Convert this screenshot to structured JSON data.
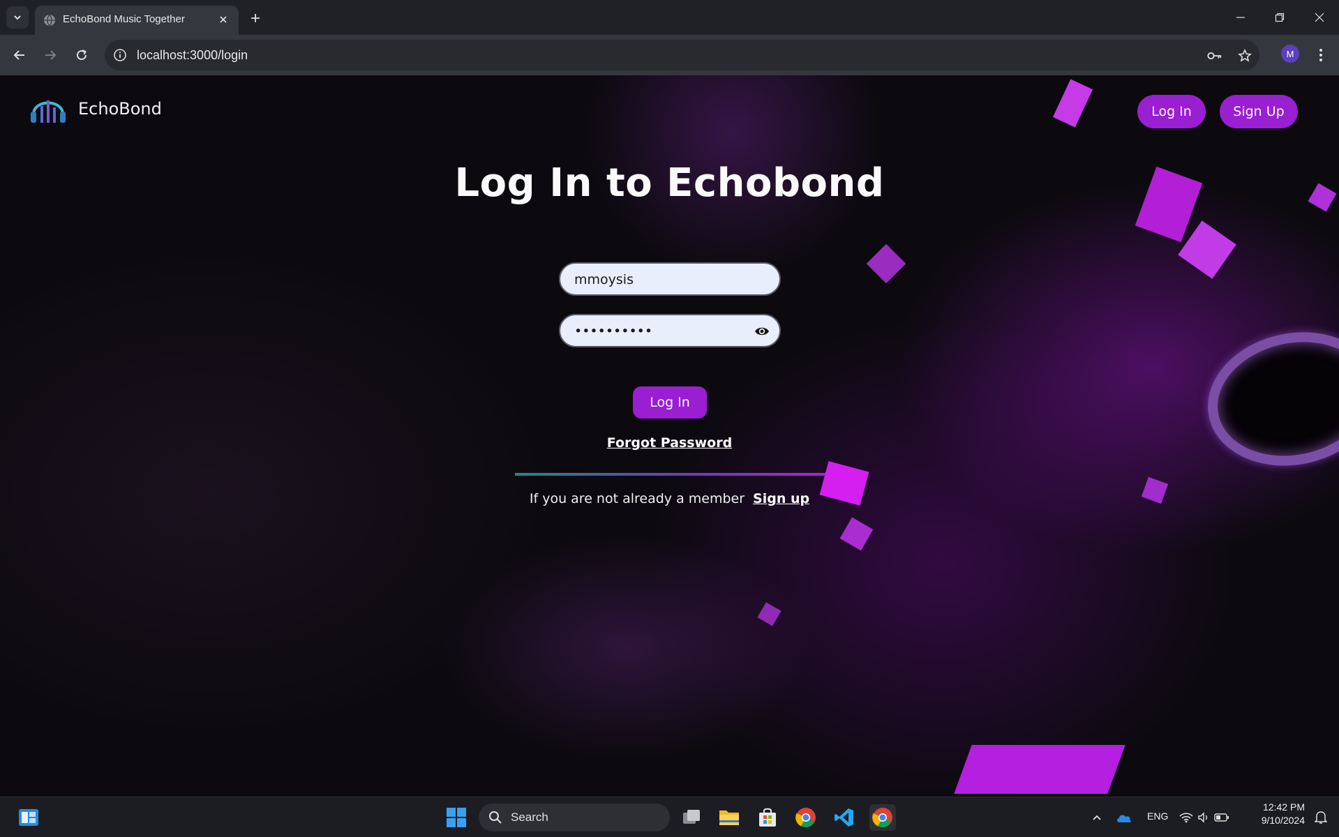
{
  "browser": {
    "tab_title": "EchoBond Music Together",
    "url": "localhost:3000/login",
    "profile_initial": "M"
  },
  "header": {
    "brand": "EchoBond",
    "login_label": "Log In",
    "signup_label": "Sign Up"
  },
  "form": {
    "title": "Log In to Echobond",
    "username_value": "mmoysis",
    "password_value": "••••••••••",
    "submit_label": "Log In",
    "forgot_label": "Forgot Password",
    "member_text": "If you are not already a member",
    "signup_link": "Sign up"
  },
  "taskbar": {
    "search_label": "Search",
    "language": "ENG",
    "time": "12:42 PM",
    "date": "9/10/2024"
  },
  "colors": {
    "accent": "#9a1ed2",
    "chrome_bg": "#1f2127",
    "toolbar_bg": "#35373e"
  }
}
